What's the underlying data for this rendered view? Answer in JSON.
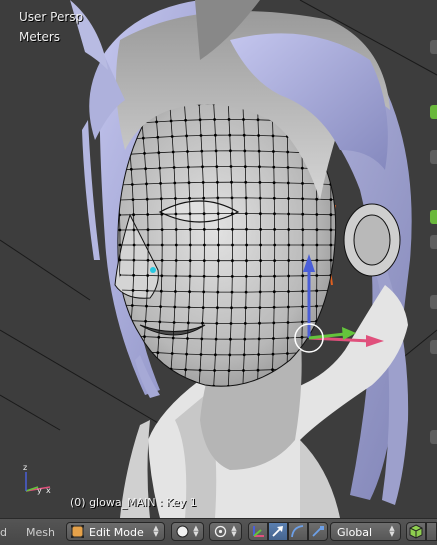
{
  "viewport": {
    "view_name": "User Persp",
    "units": "Meters",
    "object_info": "(0) glowa_MAIN : Key 1",
    "axis_labels": {
      "x": "x",
      "y": "y",
      "z": "z"
    }
  },
  "header": {
    "left_cut_text": "d",
    "menu_mesh": "Mesh",
    "mode": "Edit Mode",
    "orientation": "Global"
  },
  "colors": {
    "viewport_bg": "#3d3d3d",
    "header_bg": "#4a4a4a",
    "active_button": "#5a7fb0",
    "manipulator_x": "#e0507c",
    "manipulator_y": "#64c43c",
    "manipulator_z": "#4a5ed8",
    "hair": "#a8abd4",
    "skin": "#c8c8c8",
    "wire": "#000000",
    "selected_edge": "#e06020"
  }
}
